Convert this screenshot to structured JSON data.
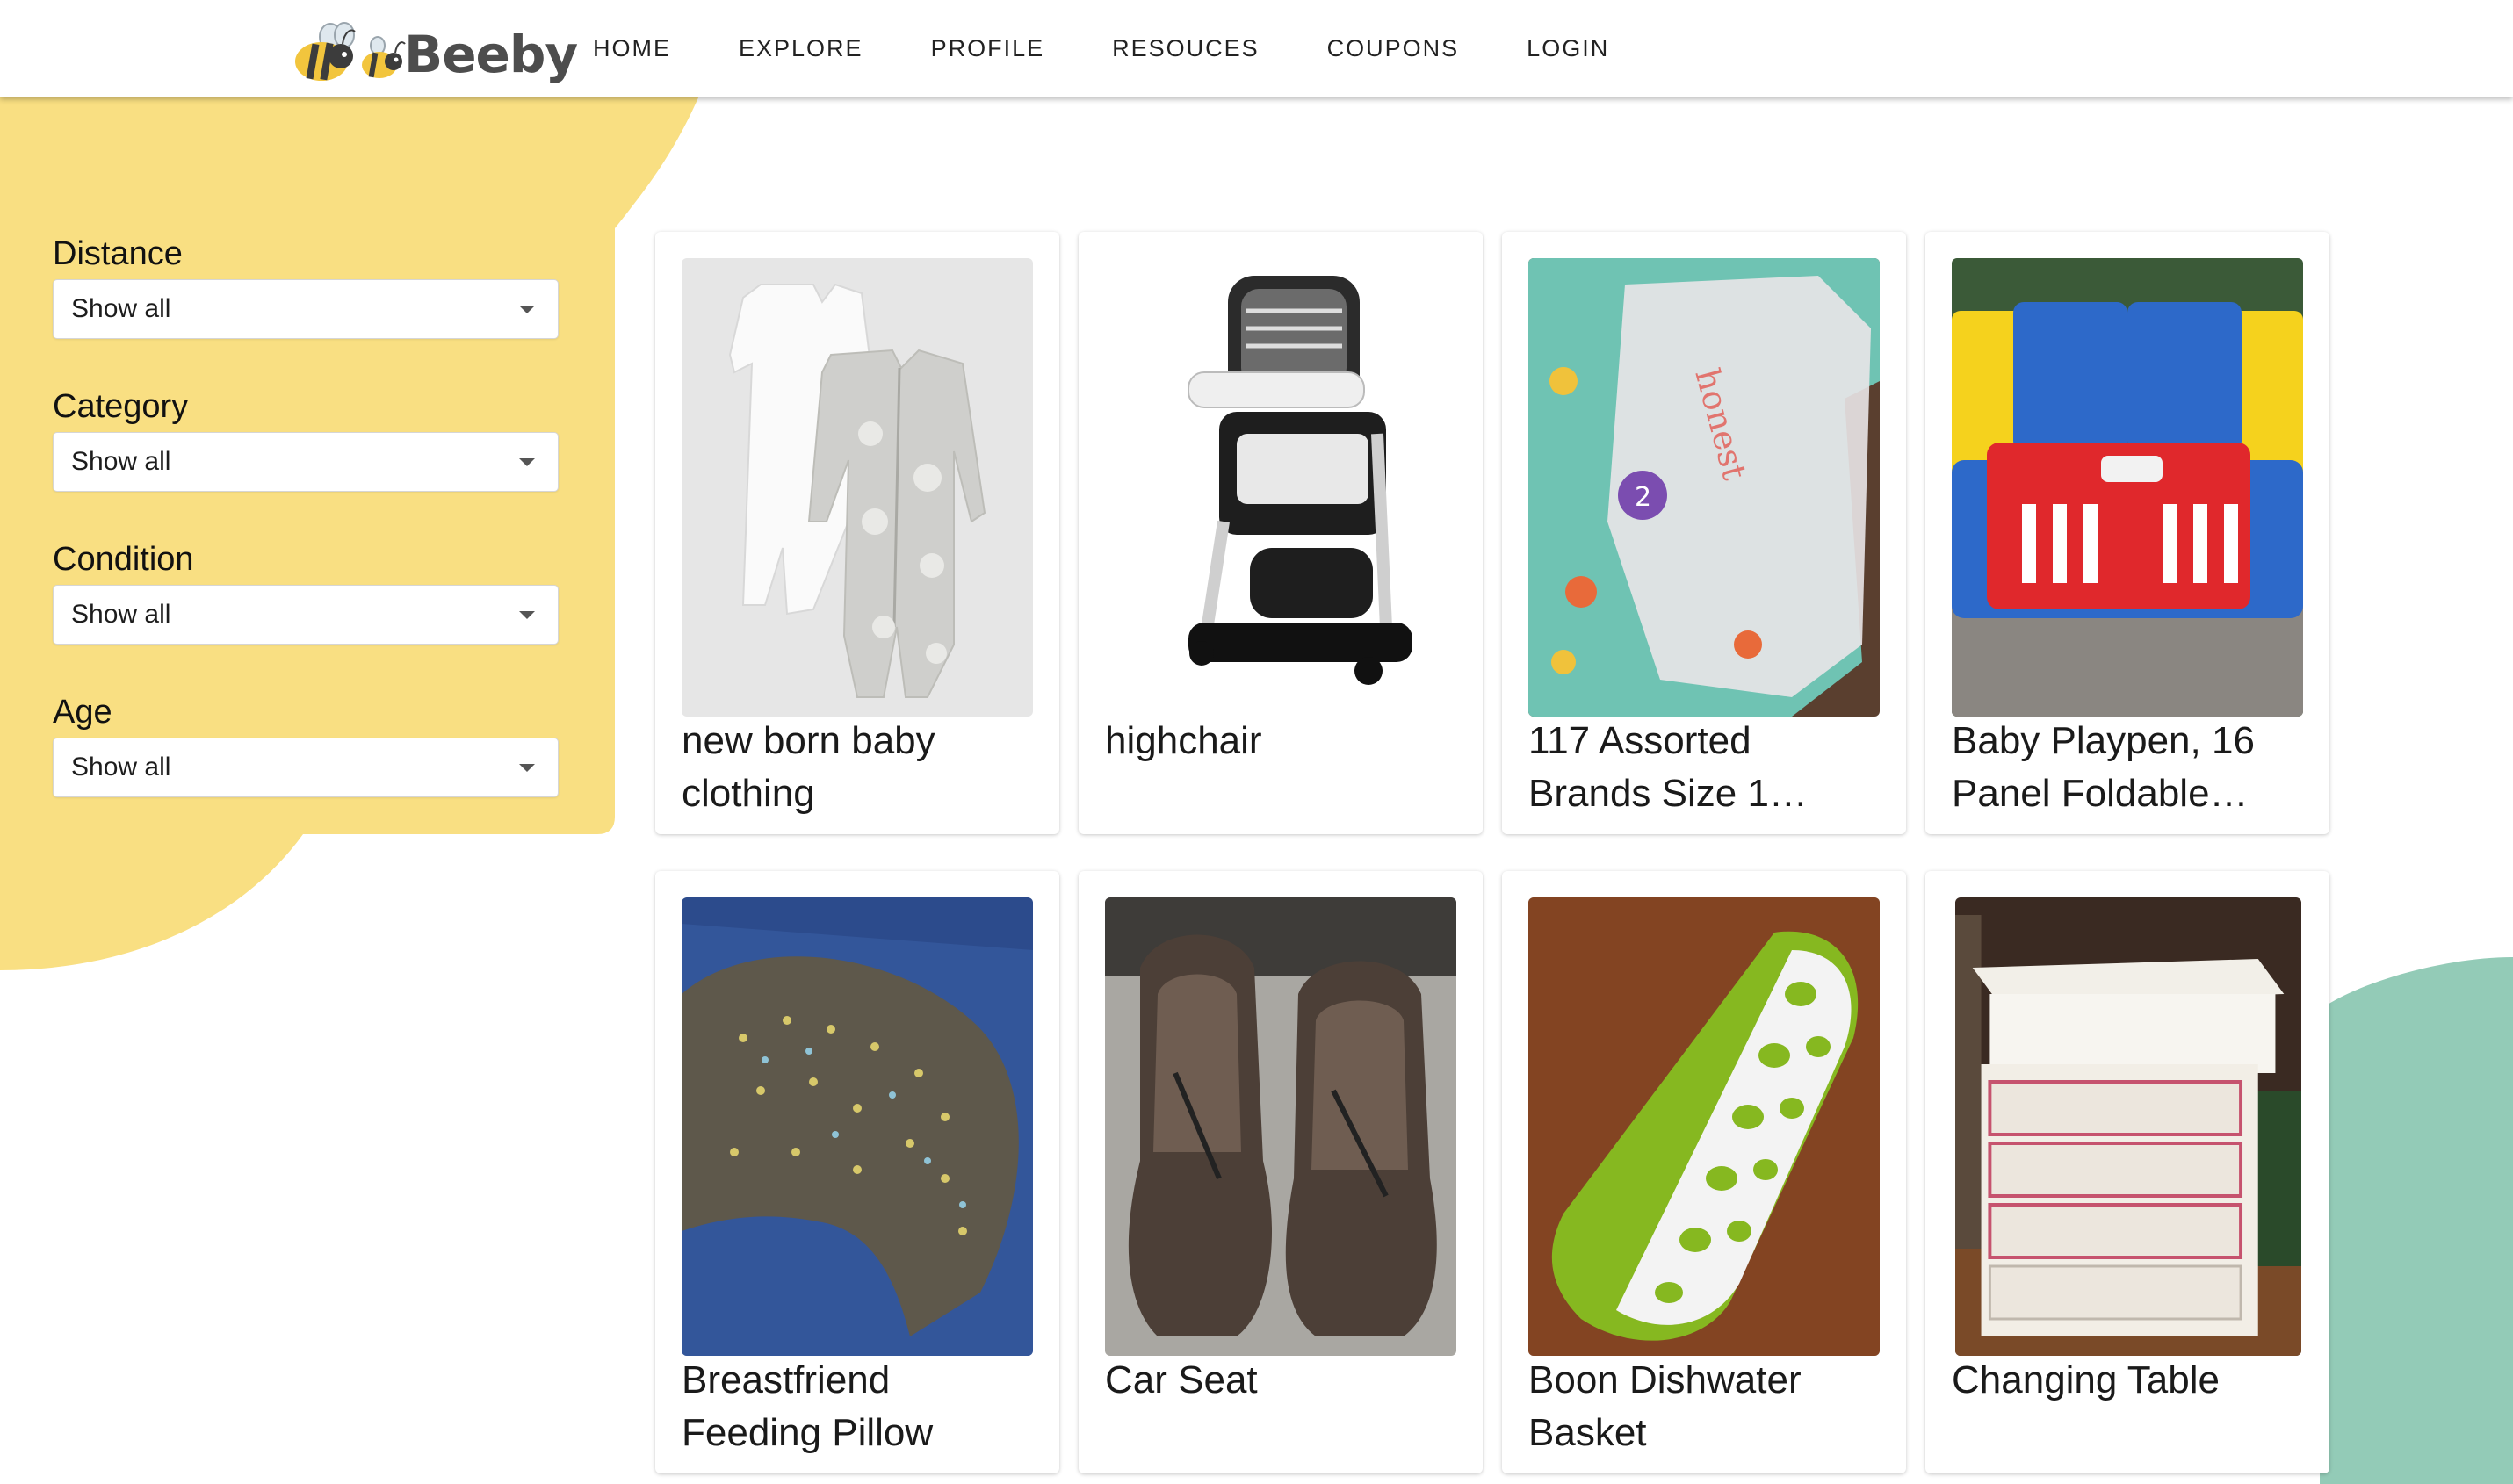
{
  "brand": {
    "name": "Beeby",
    "logo_icon": "bee-icon"
  },
  "nav": {
    "items": [
      "HOME",
      "EXPLORE",
      "PROFILE",
      "RESOUCES",
      "COUPONS",
      "LOGIN"
    ]
  },
  "filters": [
    {
      "label": "Distance",
      "value": "Show all"
    },
    {
      "label": "Category",
      "value": "Show all"
    },
    {
      "label": "Condition",
      "value": "Show all"
    },
    {
      "label": "Age",
      "value": "Show all"
    }
  ],
  "products": [
    {
      "title": "new born baby clothing",
      "image": "baby-onesies-image"
    },
    {
      "title": "highchair",
      "image": "highchair-image"
    },
    {
      "title": "117 Assorted Brands Size 1…",
      "image": "diapers-package-image"
    },
    {
      "title": "Baby Playpen, 16 Panel Foldable…",
      "image": "playpen-image"
    },
    {
      "title": "Breastfriend Feeding Pillow",
      "image": "feeding-pillow-image"
    },
    {
      "title": "Car Seat",
      "image": "car-seats-image"
    },
    {
      "title": "Boon Dishwater Basket",
      "image": "dishwasher-basket-image"
    },
    {
      "title": "Changing Table",
      "image": "changing-table-image"
    }
  ],
  "colors": {
    "accent_yellow": "#f9df82",
    "accent_teal": "#93cbb7",
    "text": "#1a1a1a"
  }
}
